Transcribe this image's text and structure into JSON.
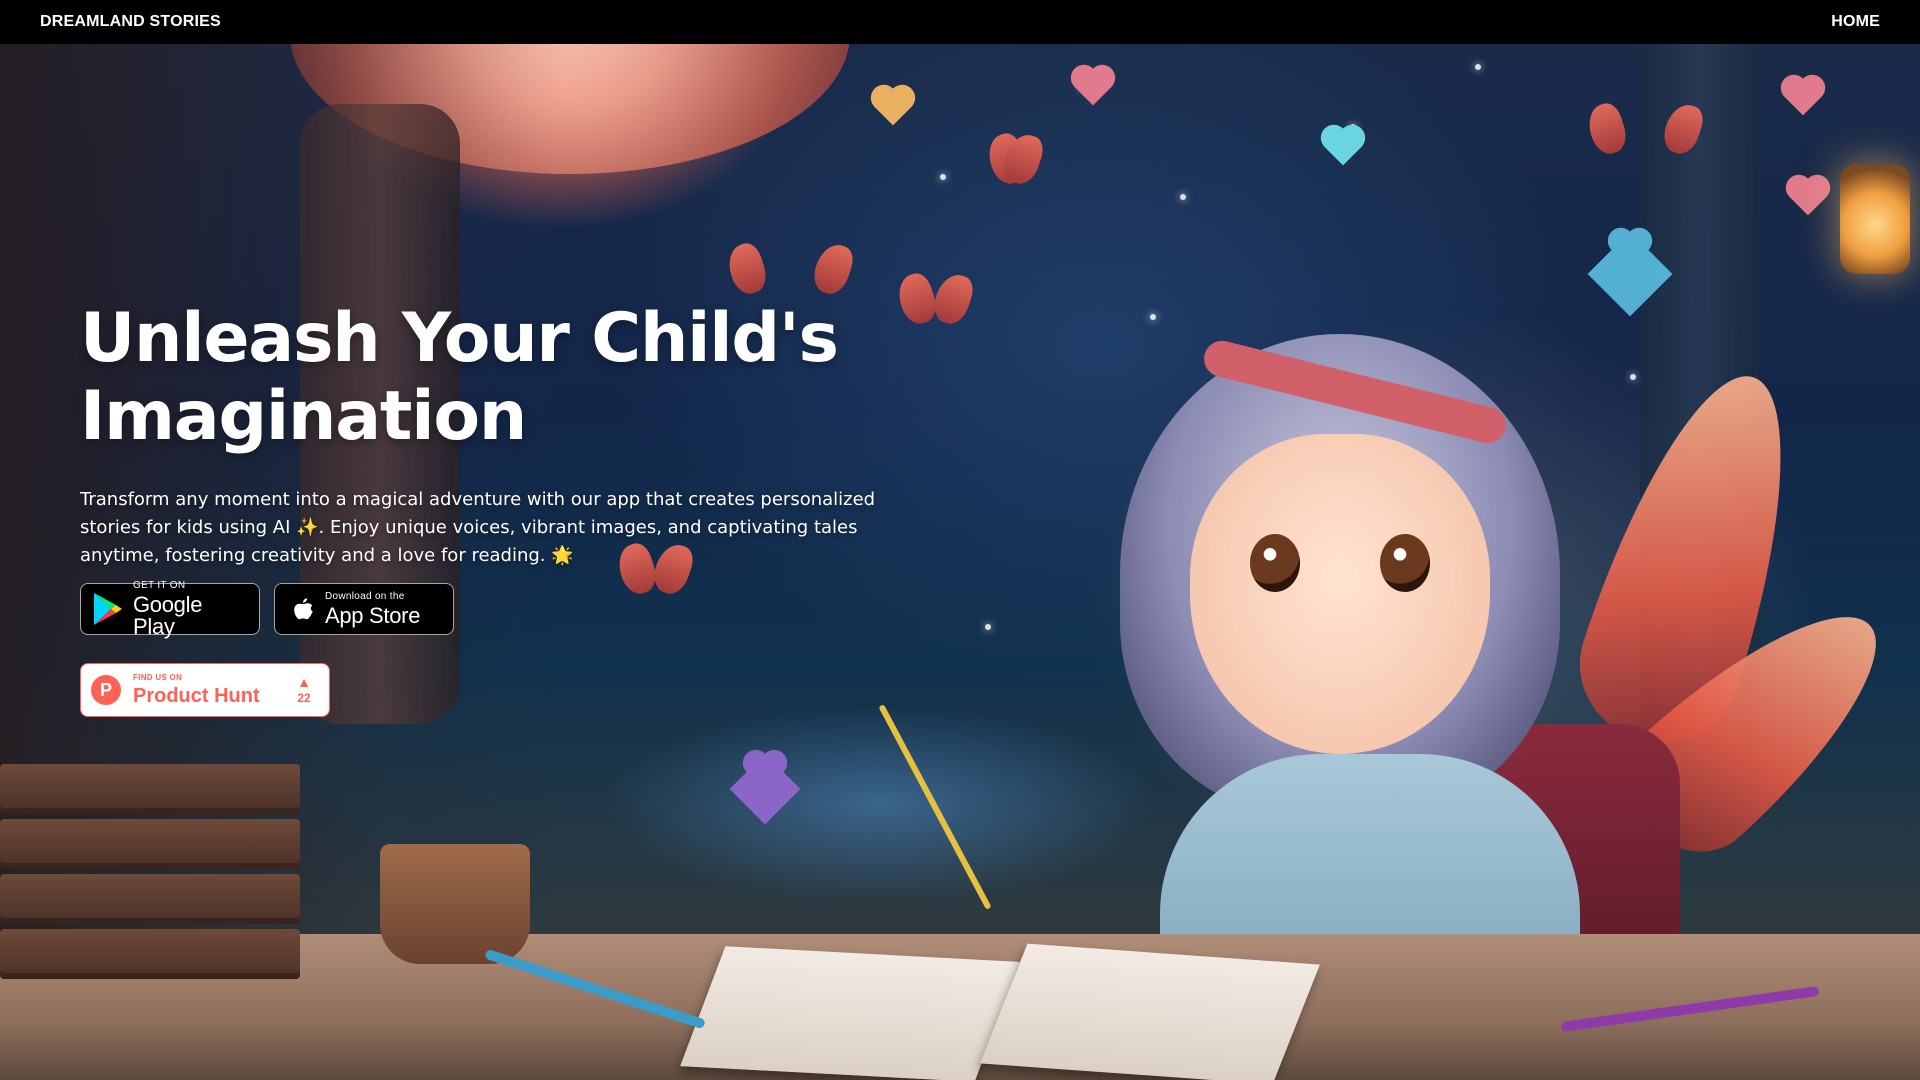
{
  "header": {
    "brand": "DREAMLAND STORIES",
    "nav_home": "HOME"
  },
  "hero": {
    "title": "Unleash Your Child's Imagination",
    "description": "Transform any moment into a magical adventure with our app that creates personalized stories for kids using AI ✨. Enjoy unique voices, vibrant images, and captivating tales anytime, fostering creativity and a love for reading. 🌟"
  },
  "store_badges": {
    "google_play": {
      "small": "GET IT ON",
      "big": "Google Play",
      "icon": "google-play-icon"
    },
    "app_store": {
      "small": "Download on the",
      "big": "App Store",
      "icon": "apple-icon"
    }
  },
  "product_hunt": {
    "small": "FIND US ON",
    "big": "Product Hunt",
    "logo_letter": "P",
    "votes": "22",
    "color": "#ff6154"
  },
  "colors": {
    "header_bg": "#000000",
    "text": "#ffffff"
  }
}
